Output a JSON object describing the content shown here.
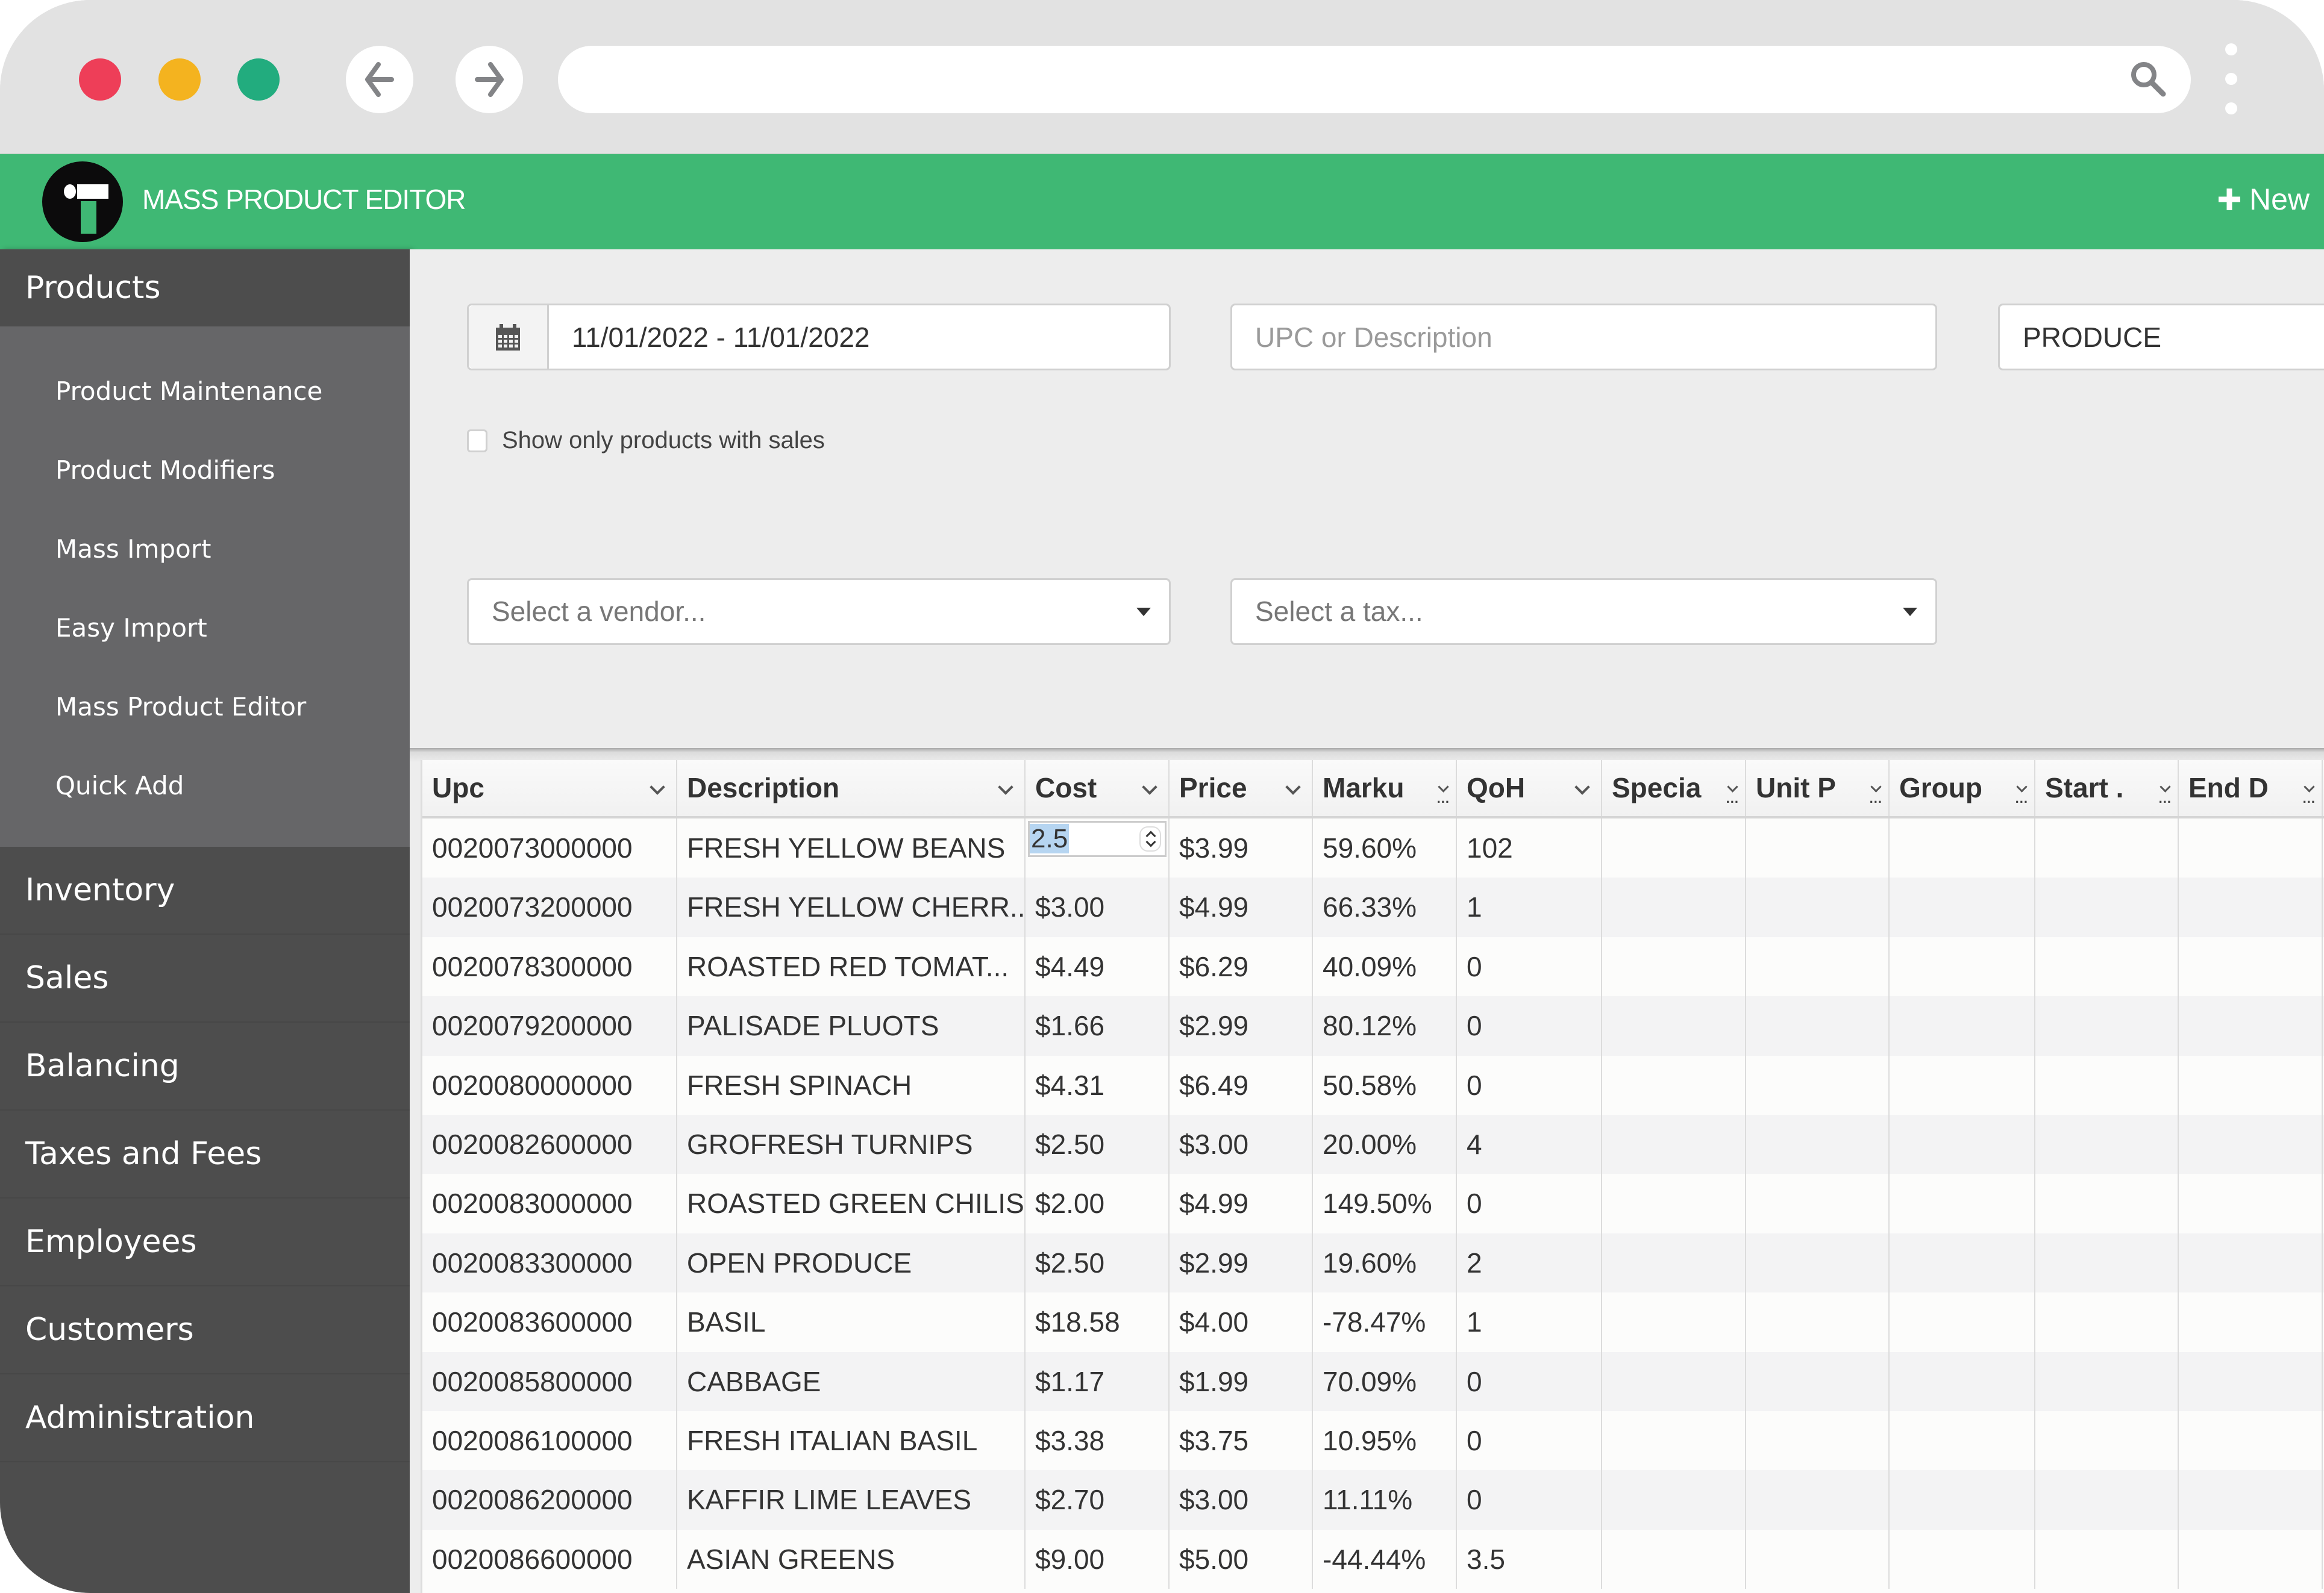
{
  "browser": {
    "window_buttons": [
      "close",
      "minimize",
      "maximize"
    ],
    "back_icon": "arrow-left-icon",
    "forward_icon": "arrow-right-icon",
    "url": "",
    "search_icon": "search-icon",
    "menu_icon": "kebab-menu-icon"
  },
  "app": {
    "title": "MASS PRODUCT EDITOR",
    "logo_icon": "t-logo-icon",
    "new_button_label": "New",
    "brand_color": "#3fb874"
  },
  "sidebar": {
    "active_section": "Products",
    "sub_items": [
      {
        "label": "Product Maintenance"
      },
      {
        "label": "Product Modifiers"
      },
      {
        "label": "Mass Import"
      },
      {
        "label": "Easy Import"
      },
      {
        "label": "Mass Product Editor"
      },
      {
        "label": "Quick Add"
      }
    ],
    "sections": [
      {
        "label": "Inventory"
      },
      {
        "label": "Sales"
      },
      {
        "label": "Balancing"
      },
      {
        "label": "Taxes and Fees"
      },
      {
        "label": "Employees"
      },
      {
        "label": "Customers"
      },
      {
        "label": "Administration"
      }
    ]
  },
  "filters": {
    "date_range": "11/01/2022 - 11/01/2022",
    "upc_search_placeholder": "UPC or Description",
    "upc_search_value": "",
    "department_value": "PRODUCE",
    "show_only_with_sales_label": "Show only products with sales",
    "show_only_with_sales_checked": false,
    "vendor_placeholder": "Select a vendor...",
    "tax_placeholder": "Select a tax..."
  },
  "grid": {
    "columns": [
      {
        "label": "Upc"
      },
      {
        "label": "Description"
      },
      {
        "label": "Cost"
      },
      {
        "label": "Price"
      },
      {
        "label": "Marku"
      },
      {
        "label": "QoH"
      },
      {
        "label": "Specia"
      },
      {
        "label": "Unit P"
      },
      {
        "label": "Group"
      },
      {
        "label": "Start ."
      },
      {
        "label": "End D"
      }
    ],
    "editing_cost_value": "2.5",
    "rows": [
      {
        "upc": "0020073000000",
        "description": "FRESH YELLOW BEANS",
        "cost": "2.5",
        "price": "$3.99",
        "markup": "59.60%",
        "qoh": "102"
      },
      {
        "upc": "0020073200000",
        "description": "FRESH YELLOW CHERR...",
        "cost": "$3.00",
        "price": "$4.99",
        "markup": "66.33%",
        "qoh": "1"
      },
      {
        "upc": "0020078300000",
        "description": "ROASTED RED TOMAT...",
        "cost": "$4.49",
        "price": "$6.29",
        "markup": "40.09%",
        "qoh": "0"
      },
      {
        "upc": "0020079200000",
        "description": "PALISADE PLUOTS",
        "cost": "$1.66",
        "price": "$2.99",
        "markup": "80.12%",
        "qoh": "0"
      },
      {
        "upc": "0020080000000",
        "description": "FRESH SPINACH",
        "cost": "$4.31",
        "price": "$6.49",
        "markup": "50.58%",
        "qoh": "0"
      },
      {
        "upc": "0020082600000",
        "description": "GROFRESH TURNIPS",
        "cost": "$2.50",
        "price": "$3.00",
        "markup": "20.00%",
        "qoh": "4"
      },
      {
        "upc": "0020083000000",
        "description": "ROASTED GREEN CHILIS",
        "cost": "$2.00",
        "price": "$4.99",
        "markup": "149.50%",
        "qoh": "0"
      },
      {
        "upc": "0020083300000",
        "description": "OPEN PRODUCE",
        "cost": "$2.50",
        "price": "$2.99",
        "markup": "19.60%",
        "qoh": "2"
      },
      {
        "upc": "0020083600000",
        "description": "BASIL",
        "cost": "$18.58",
        "price": "$4.00",
        "markup": "-78.47%",
        "qoh": "1"
      },
      {
        "upc": "0020085800000",
        "description": "CABBAGE",
        "cost": "$1.17",
        "price": "$1.99",
        "markup": "70.09%",
        "qoh": "0"
      },
      {
        "upc": "0020086100000",
        "description": "FRESH ITALIAN BASIL",
        "cost": "$3.38",
        "price": "$3.75",
        "markup": "10.95%",
        "qoh": "0"
      },
      {
        "upc": "0020086200000",
        "description": "KAFFIR LIME LEAVES",
        "cost": "$2.70",
        "price": "$3.00",
        "markup": "11.11%",
        "qoh": "0"
      },
      {
        "upc": "0020086600000",
        "description": "ASIAN GREENS",
        "cost": "$9.00",
        "price": "$5.00",
        "markup": "-44.44%",
        "qoh": "3.5"
      }
    ]
  }
}
